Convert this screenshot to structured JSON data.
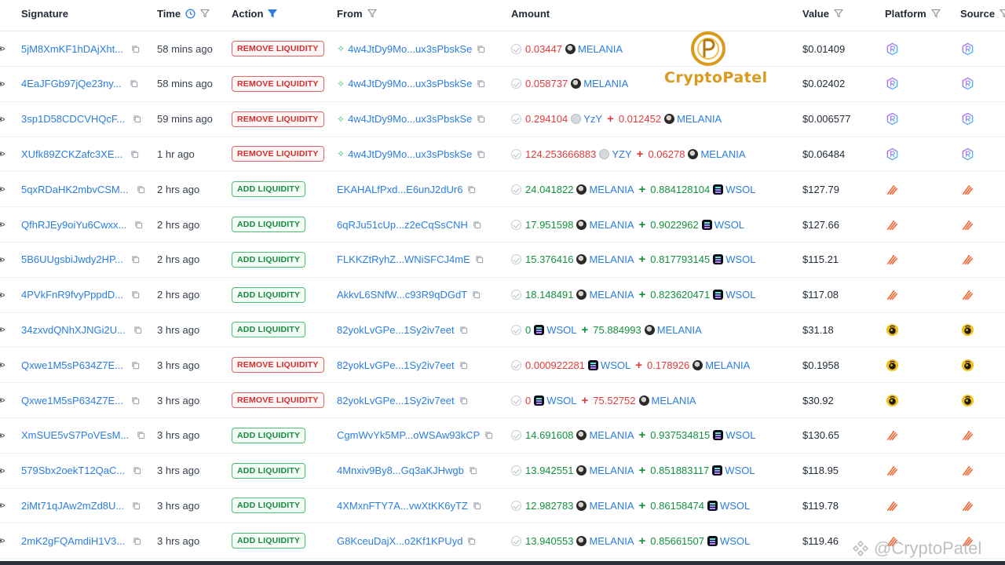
{
  "header": {
    "signature": "Signature",
    "time": "Time",
    "action": "Action",
    "from": "From",
    "amount": "Amount",
    "value": "Value",
    "platform": "Platform",
    "source": "Source"
  },
  "watermark": {
    "brand": "CryptoPatel",
    "handle": "@CryptoPatel"
  },
  "colors": {
    "link": "#2a7de1",
    "negative": "#e23b3b",
    "positive": "#12923f",
    "remove": "#d92d2d",
    "add": "#138a3c"
  },
  "rows": [
    {
      "sig": "5jM8XmKF1hDAjXht...",
      "time": "58 mins ago",
      "action": "REMOVE LIQUIDITY",
      "type": "remove",
      "from": "4w4JtDy9Mo...ux3sPbskSe",
      "spark": true,
      "a1": "0.03447",
      "t1": "MELANIA",
      "a2": "",
      "t2": "",
      "value": "$0.01409",
      "platform": "raydium"
    },
    {
      "sig": "4EaJFGb97jQe23ny...",
      "time": "58 mins ago",
      "action": "REMOVE LIQUIDITY",
      "type": "remove",
      "from": "4w4JtDy9Mo...ux3sPbskSe",
      "spark": true,
      "a1": "0.058737",
      "t1": "MELANIA",
      "a2": "",
      "t2": "",
      "value": "$0.02402",
      "platform": "raydium"
    },
    {
      "sig": "3sp1D58CDCVHQcF...",
      "time": "59 mins ago",
      "action": "REMOVE LIQUIDITY",
      "type": "remove",
      "from": "4w4JtDy9Mo...ux3sPbskSe",
      "spark": true,
      "a1": "0.294104",
      "t1": "YzY",
      "a2": "0.012452",
      "t2": "MELANIA",
      "value": "$0.006577",
      "platform": "raydium"
    },
    {
      "sig": "XUfk89ZCKZafc3XE...",
      "time": "1 hr ago",
      "action": "REMOVE LIQUIDITY",
      "type": "remove",
      "from": "4w4JtDy9Mo...ux3sPbskSe",
      "spark": true,
      "a1": "124.253666883",
      "t1": "YZY",
      "a2": "0.06278",
      "t2": "MELANIA",
      "value": "$0.06484",
      "platform": "raydium"
    },
    {
      "sig": "5qxRDaHK2mbvCSM...",
      "time": "2 hrs ago",
      "action": "ADD LIQUIDITY",
      "type": "add",
      "from": "EKAHALfPxd...E6unJ2dUr6",
      "spark": false,
      "a1": "24.041822",
      "t1": "MELANIA",
      "a2": "0.884128104",
      "t2": "WSOL",
      "value": "$127.79",
      "platform": "meteora"
    },
    {
      "sig": "QfhRJEy9oiYu6Cwxx...",
      "time": "2 hrs ago",
      "action": "ADD LIQUIDITY",
      "type": "add",
      "from": "6qRJu51cUp...z2eCqSsCNH",
      "spark": false,
      "a1": "17.951598",
      "t1": "MELANIA",
      "a2": "0.9022962",
      "t2": "WSOL",
      "value": "$127.66",
      "platform": "meteora"
    },
    {
      "sig": "5B6UUgsbiJwdy2HP...",
      "time": "2 hrs ago",
      "action": "ADD LIQUIDITY",
      "type": "add",
      "from": "FLKKZtRyhZ...WNiSFCJ4mE",
      "spark": false,
      "a1": "15.376416",
      "t1": "MELANIA",
      "a2": "0.817793145",
      "t2": "WSOL",
      "value": "$115.21",
      "platform": "meteora"
    },
    {
      "sig": "4PVkFnR9fvyPppdD...",
      "time": "2 hrs ago",
      "action": "ADD LIQUIDITY",
      "type": "add",
      "from": "AkkvL6SNfW...c93R9qDGdT",
      "spark": false,
      "a1": "18.148491",
      "t1": "MELANIA",
      "a2": "0.823620471",
      "t2": "WSOL",
      "value": "$117.08",
      "platform": "meteora"
    },
    {
      "sig": "34zxvdQNhXJNGi2U...",
      "time": "3 hrs ago",
      "action": "ADD LIQUIDITY",
      "type": "add",
      "from": "82yokLvGPe...1Sy2iv7eet",
      "spark": false,
      "a1": "0",
      "t1": "WSOL",
      "a2": "75.884993",
      "t2": "MELANIA",
      "value": "$31.18",
      "platform": "orca"
    },
    {
      "sig": "Qxwe1M5sP634Z7E...",
      "time": "3 hrs ago",
      "action": "REMOVE LIQUIDITY",
      "type": "remove",
      "from": "82yokLvGPe...1Sy2iv7eet",
      "spark": false,
      "a1": "0.000922281",
      "t1": "WSOL",
      "a2": "0.178926",
      "t2": "MELANIA",
      "value": "$0.1958",
      "platform": "orca"
    },
    {
      "sig": "Qxwe1M5sP634Z7E...",
      "time": "3 hrs ago",
      "action": "REMOVE LIQUIDITY",
      "type": "remove",
      "from": "82yokLvGPe...1Sy2iv7eet",
      "spark": false,
      "a1": "0",
      "t1": "WSOL",
      "a2": "75.52752",
      "t2": "MELANIA",
      "value": "$30.92",
      "platform": "orca"
    },
    {
      "sig": "XmSUE5vS7PoVEsM...",
      "time": "3 hrs ago",
      "action": "ADD LIQUIDITY",
      "type": "add",
      "from": "CgmWvYk5MP...oWSAw93kCP",
      "spark": false,
      "a1": "14.691608",
      "t1": "MELANIA",
      "a2": "0.937534815",
      "t2": "WSOL",
      "value": "$130.65",
      "platform": "meteora"
    },
    {
      "sig": "579Sbx2oekT12QaC...",
      "time": "3 hrs ago",
      "action": "ADD LIQUIDITY",
      "type": "add",
      "from": "4Mnxiv9By8...Gq3aKJHwgb",
      "spark": false,
      "a1": "13.942551",
      "t1": "MELANIA",
      "a2": "0.851883117",
      "t2": "WSOL",
      "value": "$118.95",
      "platform": "meteora"
    },
    {
      "sig": "2iMt71qJAw2mZd8U...",
      "time": "3 hrs ago",
      "action": "ADD LIQUIDITY",
      "type": "add",
      "from": "4XMxnFTY7A...vwXtKK6yTZ",
      "spark": false,
      "a1": "12.982783",
      "t1": "MELANIA",
      "a2": "0.86158474",
      "t2": "WSOL",
      "value": "$119.78",
      "platform": "meteora"
    },
    {
      "sig": "2mK2gFQAmdiH1V3...",
      "time": "3 hrs ago",
      "action": "ADD LIQUIDITY",
      "type": "add",
      "from": "G8KceuDajX...o2Kf1KPUyd",
      "spark": false,
      "a1": "13.940553",
      "t1": "MELANIA",
      "a2": "0.85661507",
      "t2": "WSOL",
      "value": "$119.46",
      "platform": "meteora"
    }
  ]
}
